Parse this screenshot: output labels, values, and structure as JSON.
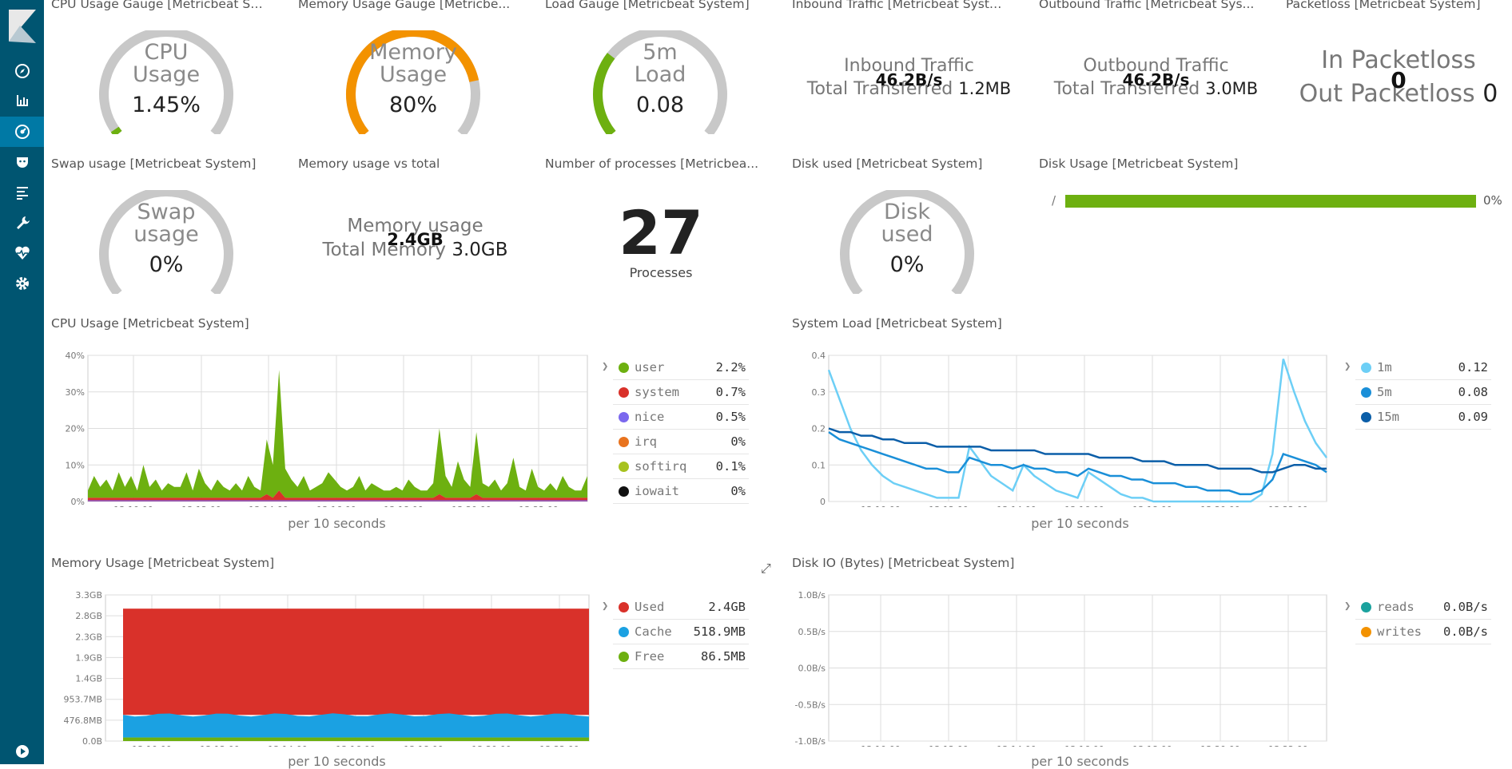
{
  "sidebar": {
    "items": [
      {
        "icon": "compass-icon"
      },
      {
        "icon": "bar-chart-icon"
      },
      {
        "icon": "dashboard-icon",
        "active": true
      },
      {
        "icon": "timelion-icon"
      },
      {
        "icon": "dev-tools-icon"
      },
      {
        "icon": "wrench-icon"
      },
      {
        "icon": "heartbeat-icon"
      },
      {
        "icon": "gear-icon"
      }
    ],
    "bottom_icon": "play-icon"
  },
  "panels": {
    "cpu_gauge": {
      "title": "CPU Usage Gauge [Metricbeat Sy...",
      "label1": "CPU",
      "label2": "Usage",
      "value": "1.45%",
      "fill": 0.0145,
      "color": "#6db010"
    },
    "mem_gauge": {
      "title": "Memory Usage Gauge [Metricbe...",
      "label1": "Memory",
      "label2": "Usage",
      "value": "80%",
      "fill": 0.8,
      "color": "#f39200"
    },
    "load_gauge": {
      "title": "Load Gauge [Metricbeat System]",
      "label1": "5m",
      "label2": "Load",
      "value": "0.08",
      "fill": 0.3,
      "color": "#6db010"
    },
    "inbound": {
      "title": "Inbound Traffic [Metricbeat Syste...",
      "label": "Inbound Traffic",
      "rate": "46.2B/s",
      "total_label": "Total Transferred",
      "total": "1.2MB"
    },
    "outbound": {
      "title": "Outbound Traffic [Metricbeat Sys...",
      "label": "Outbound Traffic",
      "rate": "46.2B/s",
      "total_label": "Total Transferred",
      "total": "3.0MB"
    },
    "packetloss": {
      "title": "Packetloss [Metricbeat System]",
      "in_label": "In Packetloss",
      "in_value": "0",
      "out_label": "Out Packetloss",
      "out_value": "0"
    },
    "swap_gauge": {
      "title": "Swap usage [Metricbeat System]",
      "label1": "Swap",
      "label2": "usage",
      "value": "0%",
      "fill": 0
    },
    "mem_total": {
      "title": "Memory usage vs total",
      "label": "Memory usage",
      "value": "2.4GB",
      "total_label": "Total Memory",
      "total": "3.0GB"
    },
    "processes": {
      "title": "Number of processes [Metricbea...",
      "value": "27",
      "label": "Processes"
    },
    "disk_gauge": {
      "title": "Disk used [Metricbeat System]",
      "label1": "Disk",
      "label2": "used",
      "value": "0%",
      "fill": 0
    },
    "disk_usage": {
      "title": "Disk Usage [Metricbeat System]",
      "mount": "/",
      "value": "0%",
      "fill": 1.0,
      "color": "#6db010"
    }
  },
  "charts": {
    "cpu": {
      "title": "CPU Usage [Metricbeat System]",
      "xlabel": "per 10 seconds",
      "legend": [
        {
          "name": "user",
          "value": "2.2%",
          "color": "#6db010"
        },
        {
          "name": "system",
          "value": "0.7%",
          "color": "#d9312a"
        },
        {
          "name": "nice",
          "value": "0.5%",
          "color": "#7b68ee"
        },
        {
          "name": "irq",
          "value": "0%",
          "color": "#e8731e"
        },
        {
          "name": "softirq",
          "value": "0.1%",
          "color": "#a7c21f"
        },
        {
          "name": "iowait",
          "value": "0%",
          "color": "#111111"
        }
      ]
    },
    "load": {
      "title": "System Load [Metricbeat System]",
      "xlabel": "per 10 seconds",
      "legend": [
        {
          "name": "1m",
          "value": "0.12",
          "color": "#6dcff6"
        },
        {
          "name": "5m",
          "value": "0.08",
          "color": "#1a8fd8"
        },
        {
          "name": "15m",
          "value": "0.09",
          "color": "#0b5ea8"
        }
      ]
    },
    "memory": {
      "title": "Memory Usage [Metricbeat System]",
      "xlabel": "per 10 seconds",
      "legend": [
        {
          "name": "Used",
          "value": "2.4GB",
          "color": "#d9312a"
        },
        {
          "name": "Cache",
          "value": "518.9MB",
          "color": "#1ba1e2"
        },
        {
          "name": "Free",
          "value": "86.5MB",
          "color": "#6db010"
        }
      ]
    },
    "diskio": {
      "title": "Disk IO (Bytes) [Metricbeat System]",
      "xlabel": "per 10 seconds",
      "legend": [
        {
          "name": "reads",
          "value": "0.0B/s",
          "color": "#1ba29e"
        },
        {
          "name": "writes",
          "value": "0.0B/s",
          "color": "#f39200"
        }
      ]
    }
  },
  "chart_data": [
    {
      "type": "area",
      "title": "CPU Usage [Metricbeat System]",
      "xlabel": "per 10 seconds",
      "x_ticks": [
        "13:10:00",
        "13:12:00",
        "13:14:00",
        "13:16:00",
        "13:18:00",
        "13:20:00",
        "13:22:00"
      ],
      "y_ticks": [
        "0%",
        "10%",
        "20%",
        "30%",
        "40%"
      ],
      "ylim": [
        0,
        40
      ],
      "series": [
        {
          "name": "user",
          "values": [
            2,
            6,
            3,
            5,
            2,
            7,
            3,
            6,
            2,
            9,
            3,
            5,
            2,
            4,
            3,
            3,
            7,
            2,
            8,
            4,
            2,
            5,
            3,
            2,
            4,
            2,
            6,
            3,
            2,
            15,
            9,
            33,
            8,
            5,
            3,
            6,
            2,
            3,
            4,
            7,
            5,
            3,
            2,
            3,
            6,
            2,
            4,
            3,
            2,
            2,
            3,
            2,
            5,
            3,
            2,
            2,
            4,
            18,
            6,
            3,
            10,
            5,
            3,
            17,
            4,
            3,
            5,
            2,
            4,
            11,
            3,
            2,
            8,
            3,
            2,
            4,
            2,
            6,
            3,
            2,
            2,
            6
          ]
        },
        {
          "name": "system",
          "values": [
            1,
            1,
            1,
            1,
            1,
            1,
            1,
            1,
            1,
            1,
            1,
            1,
            1,
            1,
            1,
            1,
            1,
            1,
            1,
            1,
            1,
            1,
            1,
            1,
            1,
            1,
            1,
            1,
            1,
            2,
            1,
            3,
            1,
            1,
            1,
            1,
            1,
            1,
            1,
            1,
            1,
            1,
            1,
            1,
            1,
            1,
            1,
            1,
            1,
            1,
            1,
            1,
            1,
            1,
            1,
            1,
            1,
            2,
            1,
            1,
            1,
            1,
            1,
            2,
            1,
            1,
            1,
            1,
            1,
            1,
            1,
            1,
            1,
            1,
            1,
            1,
            1,
            1,
            1,
            1,
            1,
            1
          ]
        }
      ]
    },
    {
      "type": "line",
      "title": "System Load [Metricbeat System]",
      "xlabel": "per 10 seconds",
      "x_ticks": [
        "13:10:00",
        "13:12:00",
        "13:14:00",
        "13:16:00",
        "13:18:00",
        "13:20:00",
        "13:22:00"
      ],
      "y_ticks": [
        "0",
        "0.1",
        "0.2",
        "0.3",
        "0.4"
      ],
      "ylim": [
        0,
        0.4
      ],
      "series": [
        {
          "name": "1m",
          "values": [
            0.36,
            0.28,
            0.2,
            0.14,
            0.1,
            0.07,
            0.05,
            0.04,
            0.03,
            0.02,
            0.01,
            0.01,
            0.01,
            0.15,
            0.11,
            0.07,
            0.05,
            0.03,
            0.1,
            0.07,
            0.05,
            0.03,
            0.02,
            0.01,
            0.08,
            0.06,
            0.04,
            0.02,
            0.01,
            0.01,
            0,
            0,
            0,
            0,
            0,
            0,
            0,
            0,
            0,
            0,
            0.02,
            0.13,
            0.39,
            0.3,
            0.22,
            0.16,
            0.12
          ]
        },
        {
          "name": "5m",
          "values": [
            0.19,
            0.17,
            0.16,
            0.15,
            0.14,
            0.13,
            0.12,
            0.11,
            0.1,
            0.09,
            0.09,
            0.08,
            0.08,
            0.12,
            0.11,
            0.1,
            0.1,
            0.09,
            0.1,
            0.09,
            0.09,
            0.08,
            0.08,
            0.07,
            0.09,
            0.08,
            0.07,
            0.07,
            0.06,
            0.06,
            0.05,
            0.05,
            0.05,
            0.04,
            0.04,
            0.03,
            0.03,
            0.03,
            0.02,
            0.02,
            0.03,
            0.06,
            0.13,
            0.12,
            0.11,
            0.1,
            0.08
          ]
        },
        {
          "name": "15m",
          "values": [
            0.2,
            0.19,
            0.19,
            0.18,
            0.18,
            0.17,
            0.17,
            0.16,
            0.16,
            0.16,
            0.15,
            0.15,
            0.15,
            0.15,
            0.15,
            0.14,
            0.14,
            0.14,
            0.14,
            0.14,
            0.13,
            0.13,
            0.13,
            0.13,
            0.13,
            0.12,
            0.12,
            0.12,
            0.12,
            0.11,
            0.11,
            0.11,
            0.1,
            0.1,
            0.1,
            0.1,
            0.09,
            0.09,
            0.09,
            0.09,
            0.08,
            0.08,
            0.09,
            0.1,
            0.1,
            0.09,
            0.09
          ]
        }
      ]
    },
    {
      "type": "area",
      "title": "Memory Usage [Metricbeat System]",
      "xlabel": "per 10 seconds",
      "x_ticks": [
        "13:10:00",
        "13:12:00",
        "13:14:00",
        "13:16:00",
        "13:18:00",
        "13:20:00",
        "13:22:00"
      ],
      "y_ticks": [
        "0.0B",
        "476.8MB",
        "953.7MB",
        "1.4GB",
        "1.9GB",
        "2.3GB",
        "2.8GB",
        "3.3GB"
      ],
      "stacked_total_gb": 3.0,
      "series": [
        {
          "name": "Free",
          "values_gb": [
            0.08,
            0.08
          ]
        },
        {
          "name": "Cache",
          "values_gb": [
            0.51,
            0.51
          ]
        },
        {
          "name": "Used",
          "values_gb": [
            2.4,
            2.4
          ]
        }
      ]
    },
    {
      "type": "line",
      "title": "Disk IO (Bytes) [Metricbeat System]",
      "xlabel": "per 10 seconds",
      "x_ticks": [
        "13:10:00",
        "13:12:00",
        "13:14:00",
        "13:16:00",
        "13:18:00",
        "13:20:00",
        "13:22:00"
      ],
      "y_ticks": [
        "-1.0B/s",
        "-0.5B/s",
        "0.0B/s",
        "0.5B/s",
        "1.0B/s"
      ],
      "series": [
        {
          "name": "reads",
          "values": []
        },
        {
          "name": "writes",
          "values": []
        }
      ]
    }
  ]
}
